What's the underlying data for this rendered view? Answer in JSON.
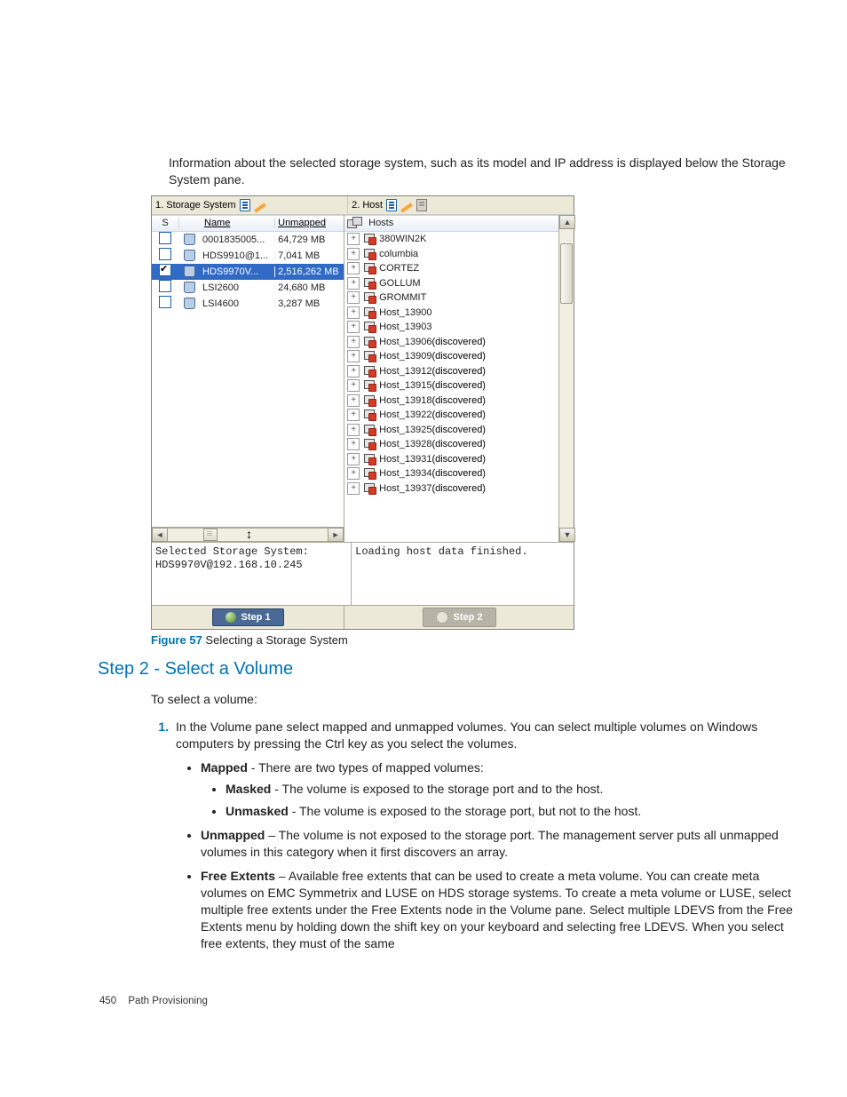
{
  "intro": "Information about the selected storage system, such as its model and IP address is displayed below the Storage System pane.",
  "shot": {
    "storage_tab": "1. Storage System",
    "host_tab": "2. Host",
    "cols": {
      "s": "S",
      "name": "Name",
      "unmapped": "Unmapped"
    },
    "rows": [
      {
        "checked": false,
        "name": "0001835005...",
        "unmapped": "64,729 MB",
        "sel": false
      },
      {
        "checked": false,
        "name": "HDS9910@1...",
        "unmapped": "7,041 MB",
        "sel": false
      },
      {
        "checked": true,
        "name": "HDS9970V...",
        "unmapped": "2,516,262 MB",
        "sel": true
      },
      {
        "checked": false,
        "name": "LSI2600",
        "unmapped": "24,680 MB",
        "sel": false
      },
      {
        "checked": false,
        "name": "LSI4600",
        "unmapped": "3,287 MB",
        "sel": false
      }
    ],
    "hosts_header": "Hosts",
    "hosts": [
      {
        "name": "380WIN2K",
        "disc": ""
      },
      {
        "name": "columbia",
        "disc": ""
      },
      {
        "name": "CORTEZ",
        "disc": ""
      },
      {
        "name": "GOLLUM",
        "disc": ""
      },
      {
        "name": "GROMMIT",
        "disc": ""
      },
      {
        "name": "Host_13900",
        "disc": ""
      },
      {
        "name": "Host_13903",
        "disc": ""
      },
      {
        "name": "Host_13906",
        "disc": "(discovered)"
      },
      {
        "name": "Host_13909",
        "disc": "(discovered)"
      },
      {
        "name": "Host_13912",
        "disc": "(discovered)"
      },
      {
        "name": "Host_13915",
        "disc": "(discovered)"
      },
      {
        "name": "Host_13918",
        "disc": "(discovered)"
      },
      {
        "name": "Host_13922",
        "disc": "(discovered)"
      },
      {
        "name": "Host_13925",
        "disc": "(discovered)"
      },
      {
        "name": "Host_13928",
        "disc": "(discovered)"
      },
      {
        "name": "Host_13931",
        "disc": "(discovered)"
      },
      {
        "name": "Host_13934",
        "disc": "(discovered)"
      },
      {
        "name": "Host_13937",
        "disc": "(discovered)"
      }
    ],
    "selected_label": "Selected Storage System:",
    "selected_value": "HDS9970V@192.168.10.245",
    "host_status": "Loading host data finished.",
    "step1": "Step 1",
    "step2": "Step 2"
  },
  "caption": {
    "fig": "Figure 57",
    "text": "Selecting a Storage System"
  },
  "h2": "Step 2 - Select a Volume",
  "lead": "To select a volume:",
  "ol1": "In the Volume pane select mapped and unmapped volumes. You can select multiple volumes on Windows computers by pressing the Ctrl key as you select the volumes.",
  "bullets": {
    "mapped": {
      "head": "Mapped",
      "tail": " - There are two types of mapped volumes:"
    },
    "masked": {
      "head": "Masked",
      "tail": " - The volume is exposed to the storage port and to the host."
    },
    "unmasked": {
      "head": "Unmasked",
      "tail": " - The volume is exposed to the storage port, but not to the host."
    },
    "unmapped": {
      "head": "Unmapped",
      "tail": " – The volume is not exposed to the storage port. The management server puts all unmapped volumes in this category when it first discovers an array."
    },
    "free": {
      "head": "Free Extents",
      "tail": " – Available free extents that can be used to create a meta volume. You can create meta volumes on EMC Symmetrix and LUSE on HDS storage systems. To create a meta volume or LUSE, select multiple free extents under the Free Extents node in the Volume pane. Select multiple LDEVS from the Free Extents menu by holding down the shift key on your keyboard and selecting free LDEVS. When you select free extents, they must of the same"
    }
  },
  "footer": {
    "page": "450",
    "section": "Path Provisioning"
  }
}
